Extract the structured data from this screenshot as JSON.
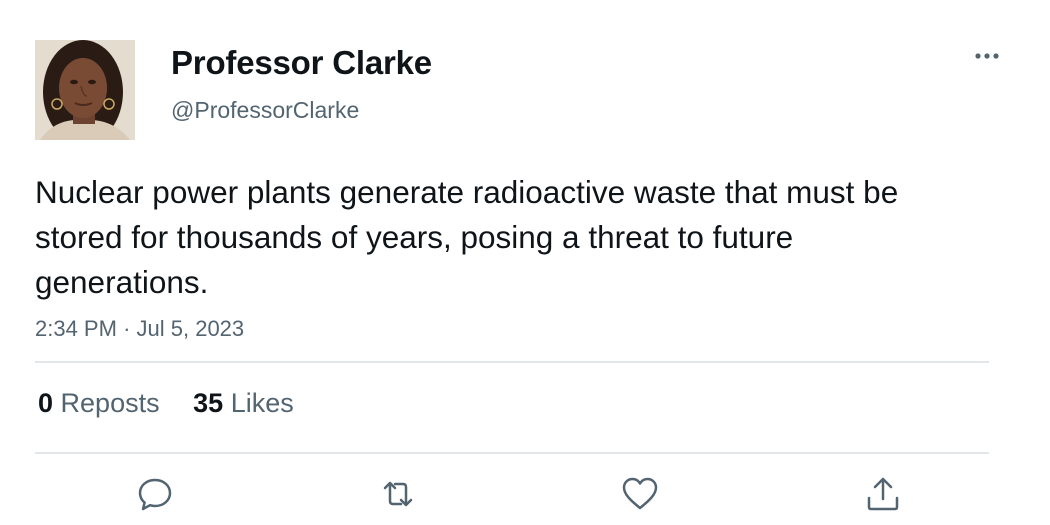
{
  "author": {
    "display_name": "Professor Clarke",
    "handle": "@ProfessorClarke",
    "avatar": "avatar-photo"
  },
  "tweet": {
    "text": "Nuclear power plants generate radioactive waste that must be stored for thousands of years, posing a threat to future generations.",
    "time": "2:34 PM",
    "separator": "·",
    "date": "Jul 5, 2023"
  },
  "stats": {
    "reposts_count": "0",
    "reposts_label": "Reposts",
    "likes_count": "35",
    "likes_label": "Likes"
  },
  "icons": {
    "more": "more-options-icon",
    "reply": "reply-icon",
    "repost": "repost-icon",
    "like": "like-icon",
    "share": "share-icon"
  },
  "colors": {
    "text": "#0f1419",
    "secondary": "#536471",
    "divider": "#e3e6e8"
  }
}
